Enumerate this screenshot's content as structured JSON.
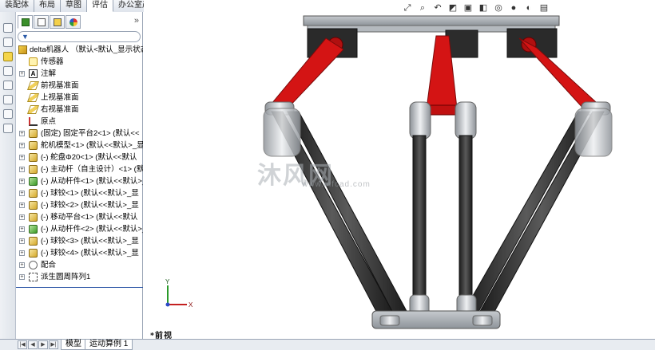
{
  "top_tabs": [
    "装配体",
    "布局",
    "草图",
    "评估",
    "办公室产品"
  ],
  "active_top_tab": "评估",
  "panel": {
    "expand_glyph": "»",
    "filter_icon": "filter-icon",
    "tree": [
      {
        "label": "delta机器人 （默认<默认_显示状态",
        "icon": "assembly-icon",
        "depth": 0,
        "expander": ""
      },
      {
        "label": "传感器",
        "icon": "sensor-icon",
        "depth": 1,
        "expander": ""
      },
      {
        "label": "注解",
        "icon": "annotation-icon",
        "depth": 1,
        "expander": "+"
      },
      {
        "label": "前视基准面",
        "icon": "plane-icon",
        "depth": 1,
        "expander": ""
      },
      {
        "label": "上视基准面",
        "icon": "plane-icon",
        "depth": 1,
        "expander": ""
      },
      {
        "label": "右视基准面",
        "icon": "plane-icon",
        "depth": 1,
        "expander": ""
      },
      {
        "label": "原点",
        "icon": "origin-icon",
        "depth": 1,
        "expander": ""
      },
      {
        "label": "(固定) 固定平台2<1> (默认<<",
        "icon": "part-icon",
        "depth": 1,
        "expander": "+"
      },
      {
        "label": "舵机模型<1> (默认<<默认>_显",
        "icon": "part-icon",
        "depth": 1,
        "expander": "+"
      },
      {
        "label": "(-) 舵盘Φ20<1> (默认<<默认",
        "icon": "part-icon",
        "depth": 1,
        "expander": "+"
      },
      {
        "label": "(-) 主动杆（自主设计）<1> (默",
        "icon": "part-icon",
        "depth": 1,
        "expander": "+"
      },
      {
        "label": "(-) 从动杆件<1> (默认<<默认>_显",
        "icon": "part-green-icon",
        "depth": 1,
        "expander": "+"
      },
      {
        "label": "(-) 球铰<1> (默认<<默认>_显",
        "icon": "part-icon",
        "depth": 1,
        "expander": "+"
      },
      {
        "label": "(-) 球铰<2> (默认<<默认>_显",
        "icon": "part-icon",
        "depth": 1,
        "expander": "+"
      },
      {
        "label": "(-) 移动平台<1> (默认<<默认",
        "icon": "part-icon",
        "depth": 1,
        "expander": "+"
      },
      {
        "label": "(-) 从动杆件<2> (默认<<默认>_显",
        "icon": "part-green-icon",
        "depth": 1,
        "expander": "+"
      },
      {
        "label": "(-) 球铰<3> (默认<<默认>_显",
        "icon": "part-icon",
        "depth": 1,
        "expander": "+"
      },
      {
        "label": "(-) 球铰<4> (默认<<默认>_显",
        "icon": "part-icon",
        "depth": 1,
        "expander": "+"
      },
      {
        "label": "配合",
        "icon": "mate-icon",
        "depth": 1,
        "expander": "+"
      },
      {
        "label": "派生圆周阵列1",
        "icon": "pattern-icon",
        "depth": 1,
        "expander": "+"
      }
    ]
  },
  "bottom": {
    "tab_model": "模型",
    "tab_motion": "运动算例 1"
  },
  "graphics": {
    "view_label": "*前视",
    "watermark": "沐风网",
    "watermark_url": "www.mfcad.com",
    "hud_icons": [
      "zoom-fit-icon",
      "zoom-area-icon",
      "previous-view-icon",
      "section-view-icon",
      "view-orientation-icon",
      "display-style-icon",
      "hide-show-icon",
      "appearance-icon",
      "scene-icon",
      "view-settings-icon"
    ],
    "triad": {
      "x": "X",
      "y": "Y"
    },
    "colors": {
      "driver_arm": "#d41414",
      "rod": "#3a3a3a",
      "joint": "#c8ccd0",
      "platform": "#9aa0a6"
    }
  }
}
